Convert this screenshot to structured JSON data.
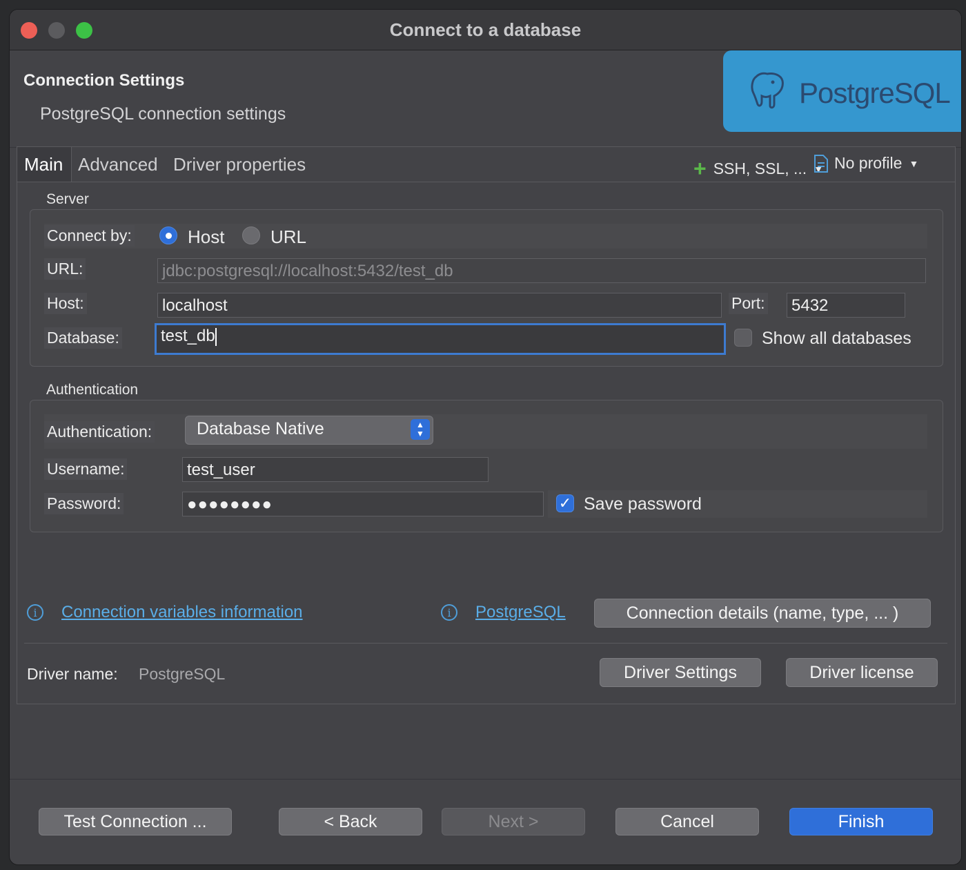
{
  "window": {
    "title": "Connect to a database"
  },
  "header": {
    "title": "Connection Settings",
    "subtitle": "PostgreSQL connection settings",
    "logo_text": "PostgreSQL"
  },
  "tabs": [
    {
      "label": "Main",
      "active": true
    },
    {
      "label": "Advanced"
    },
    {
      "label": "Driver properties"
    }
  ],
  "toolbar": {
    "ssh_label": "SSH, SSL, ...",
    "profile_label": "No profile"
  },
  "server": {
    "group_title": "Server",
    "connect_by_label": "Connect by:",
    "host_option": "Host",
    "url_option": "URL",
    "selected": "Host",
    "url_label": "URL:",
    "url_value": "jdbc:postgresql://localhost:5432/test_db",
    "host_label": "Host:",
    "host_value": "localhost",
    "port_label": "Port:",
    "port_value": "5432",
    "database_label": "Database:",
    "database_value": "test_db",
    "show_all_label": "Show all databases",
    "show_all_checked": false
  },
  "auth": {
    "group_title": "Authentication",
    "auth_label": "Authentication:",
    "auth_value": "Database Native",
    "username_label": "Username:",
    "username_value": "test_user",
    "password_label": "Password:",
    "password_value": "●●●●●●●●",
    "save_password_label": "Save password",
    "save_password_checked": true
  },
  "links": {
    "conn_vars": "Connection variables information",
    "postgres": "PostgreSQL",
    "conn_details_button": "Connection details (name, type, ... )"
  },
  "driver": {
    "name_label": "Driver name:",
    "name_value": "PostgreSQL",
    "settings_button": "Driver Settings",
    "license_button": "Driver license"
  },
  "footer": {
    "test_button": "Test Connection ...",
    "back_button": "< Back",
    "next_button": "Next >",
    "cancel_button": "Cancel",
    "finish_button": "Finish"
  },
  "colors": {
    "accent": "#2f6fd9",
    "link": "#5aaee8",
    "logo_bg": "#3597cf"
  }
}
